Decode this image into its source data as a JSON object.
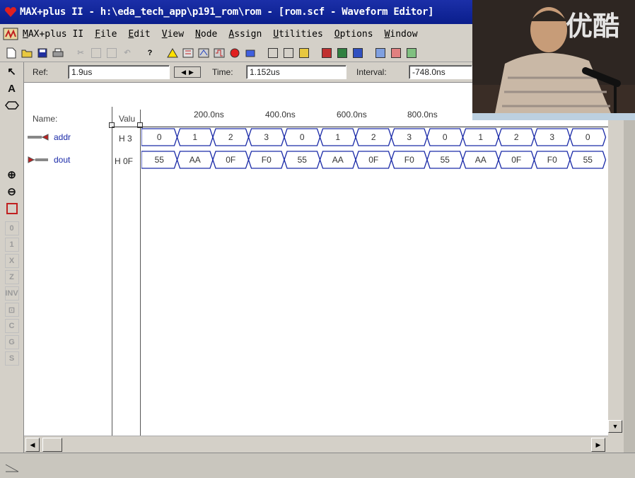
{
  "window": {
    "title": "MAX+plus II - h:\\eda_tech_app\\p191_rom\\rom - [rom.scf - Waveform Editor]"
  },
  "menu": [
    "MAX+plus II",
    "File",
    "Edit",
    "View",
    "Node",
    "Assign",
    "Utilities",
    "Options",
    "Window"
  ],
  "toolbar": {
    "help_label": "?"
  },
  "left_tools": {
    "select": "↖",
    "text": "A",
    "zoom_in": "⊕",
    "zoom_out": "⊖"
  },
  "infobar": {
    "ref_label": "Ref:",
    "ref_value": "1.9us",
    "time_label": "Time:",
    "time_value": "1.152us",
    "interval_label": "Interval:",
    "interval_value": "-748.0ns"
  },
  "columns": {
    "name": "Name:",
    "value": "Valu"
  },
  "timeline": [
    "200.0ns",
    "400.0ns",
    "600.0ns",
    "800.0ns"
  ],
  "signals": [
    {
      "name": "addr",
      "value": "H 3",
      "segments": [
        "0",
        "1",
        "2",
        "3",
        "0",
        "1",
        "2",
        "3",
        "0",
        "1",
        "2",
        "3",
        "0"
      ]
    },
    {
      "name": "dout",
      "value": "H 0F",
      "segments": [
        "55",
        "AA",
        "0F",
        "F0",
        "55",
        "AA",
        "0F",
        "F0",
        "55",
        "AA",
        "0F",
        "F0",
        "55"
      ]
    }
  ],
  "watermark": "优酷",
  "colors": {
    "titlebar": "#0a1e8c",
    "waveform": "#1a2aa8",
    "window_bg": "#d4d0c8"
  }
}
